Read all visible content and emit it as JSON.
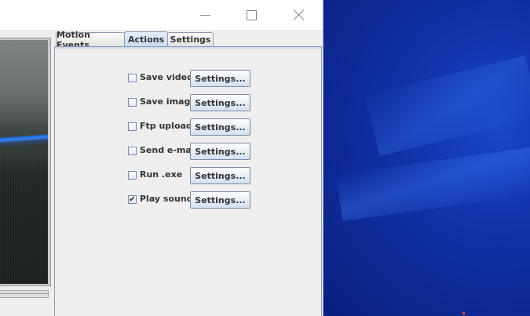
{
  "window": {
    "controls": {
      "minimize_icon": "minimize-icon",
      "maximize_icon": "maximize-icon",
      "close_icon": "close-icon"
    }
  },
  "tabs": [
    {
      "label": "Motion Events",
      "selected": false
    },
    {
      "label": "Actions",
      "selected": true
    },
    {
      "label": "Settings",
      "selected": false
    }
  ],
  "actions": [
    {
      "label": "Save video",
      "checked": false,
      "button": "Settings..."
    },
    {
      "label": "Save image",
      "checked": false,
      "button": "Settings..."
    },
    {
      "label": "Ftp upload",
      "checked": false,
      "button": "Settings..."
    },
    {
      "label": "Send e-mail",
      "checked": false,
      "button": "Settings..."
    },
    {
      "label": "Run .exe",
      "checked": false,
      "button": "Settings..."
    },
    {
      "label": "Play sound",
      "checked": true,
      "button": "Settings..."
    }
  ],
  "check_mark": "✔",
  "colors": {
    "selected_tab": "#c9daf0",
    "desktop": "#0f2fa3"
  }
}
